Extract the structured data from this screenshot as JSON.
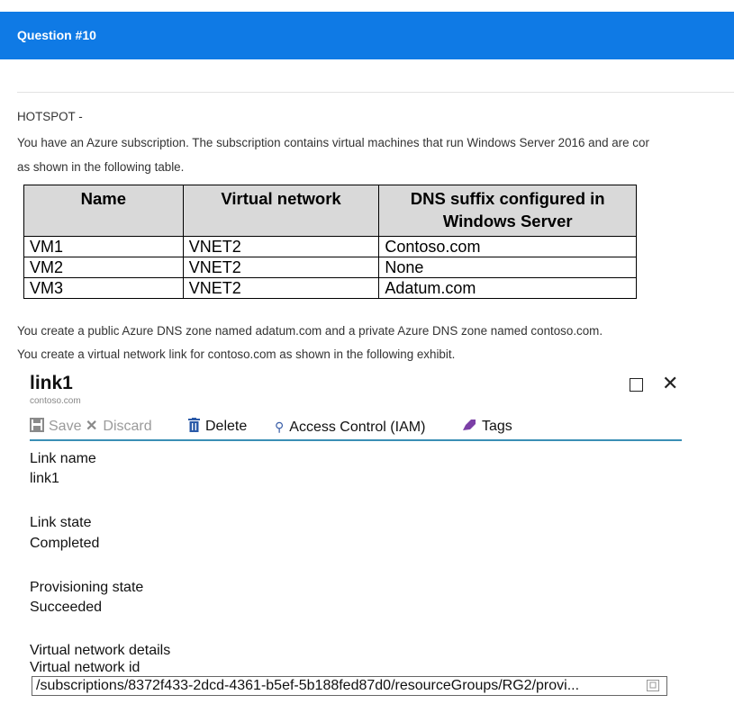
{
  "header": {
    "title": "Question #10"
  },
  "question": {
    "type_label": "HOTSPOT -",
    "line1": "You have an Azure subscription. The subscription contains virtual machines that run Windows Server 2016 and are cor",
    "line2": "as shown in the following table.",
    "line3": "You create a public Azure DNS zone named adatum.com and a private Azure DNS zone named contoso.com.",
    "line4": "You create a virtual network link for contoso.com as shown in the following exhibit."
  },
  "vm_table": {
    "headers": [
      "Name",
      "Virtual network",
      "DNS suffix configured in Windows Server"
    ],
    "header3_line1": "DNS suffix configured in",
    "header3_line2": "Windows Server",
    "rows": [
      [
        "VM1",
        "VNET2",
        "Contoso.com"
      ],
      [
        "VM2",
        "VNET2",
        "None"
      ],
      [
        "VM3",
        "VNET2",
        "Adatum.com"
      ]
    ]
  },
  "exhibit": {
    "title": "link1",
    "subtitle": "contoso.com",
    "toolbar": {
      "save": "Save",
      "discard": "Discard",
      "delete": "Delete",
      "access_control": "Access Control (IAM)",
      "tags": "Tags"
    },
    "fields": {
      "link_name_label": "Link name",
      "link_name_value": "link1",
      "link_state_label": "Link state",
      "link_state_value": "Completed",
      "provisioning_state_label": "Provisioning state",
      "provisioning_state_value": "Succeeded",
      "vnet_details_label": "Virtual network details",
      "vnet_id_label": "Virtual network id",
      "vnet_id_value": "/subscriptions/8372f433-2dcd-4361-b5ef-5b188fed87d0/resourceGroups/RG2/provi..."
    }
  },
  "colors": {
    "header_bg": "#0f7ae5",
    "toolbar_underline": "#3a8fb5",
    "tags_icon": "#7b3fa6",
    "delete_icon": "#2a5aa8"
  },
  "icons": [
    "save-icon",
    "discard-icon",
    "delete-icon",
    "access-control-icon",
    "tags-icon",
    "maximize-icon",
    "close-icon",
    "copy-icon"
  ]
}
